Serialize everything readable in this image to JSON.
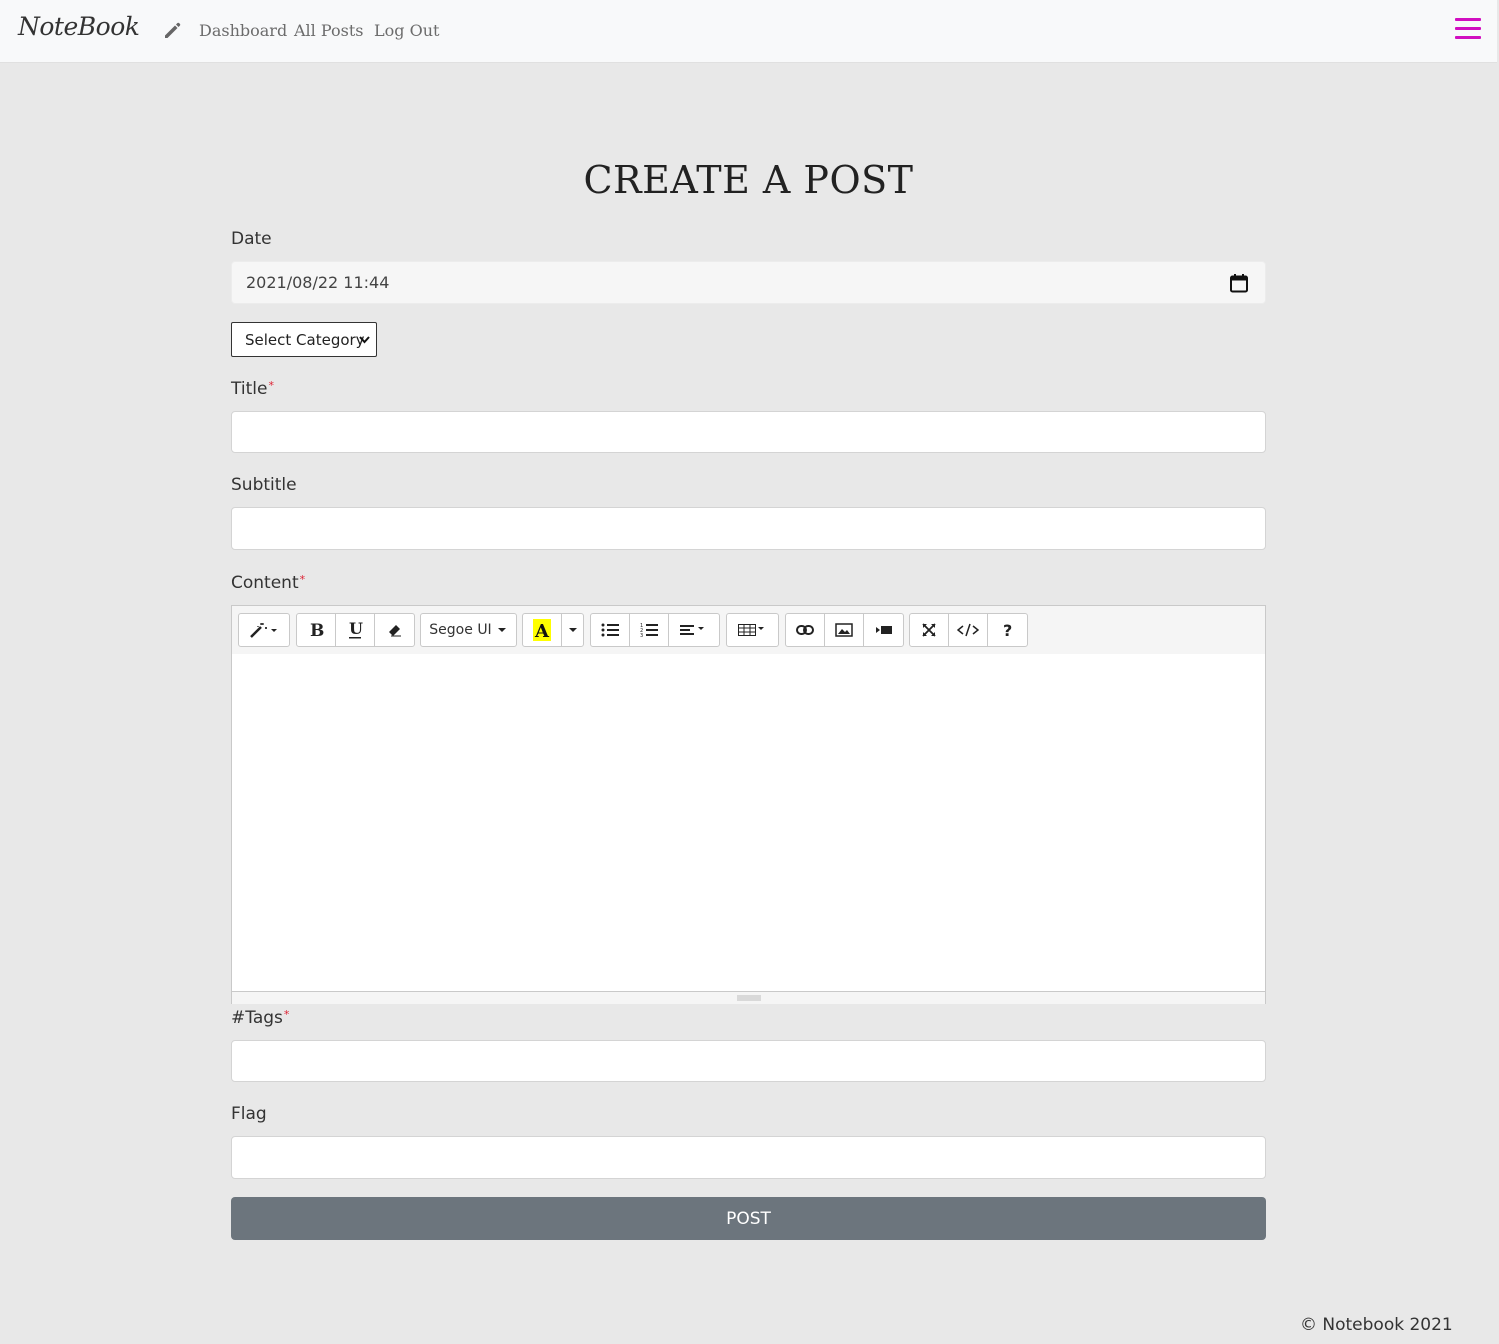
{
  "navbar": {
    "brand": "NoteBook",
    "links": [
      "Dashboard",
      "All Posts",
      "Log Out"
    ],
    "accent_color": "#d10ec0"
  },
  "page": {
    "title": "CREATE A POST"
  },
  "form": {
    "date_label": "Date",
    "date_value": "2021/08/22  11:44",
    "category_selected": "Select Category",
    "title_label": "Title",
    "subtitle_label": "Subtitle",
    "content_label": "Content",
    "tags_label": "#Tags",
    "flag_label": "Flag",
    "required_mark": "*",
    "submit_label": "POST"
  },
  "editor": {
    "font_name": "Segoe UI",
    "toolbar_icons": [
      "magic-wand-icon",
      "bold-icon",
      "underline-icon",
      "eraser-icon",
      "font-family-icon",
      "highlight-icon",
      "bullet-list-icon",
      "ordered-list-icon",
      "align-icon",
      "table-icon",
      "link-icon",
      "picture-icon",
      "video-icon",
      "fullscreen-icon",
      "code-view-icon",
      "help-icon"
    ],
    "highlight_color": "#ffff00"
  },
  "footer": {
    "copyright": "© Notebook 2021"
  }
}
